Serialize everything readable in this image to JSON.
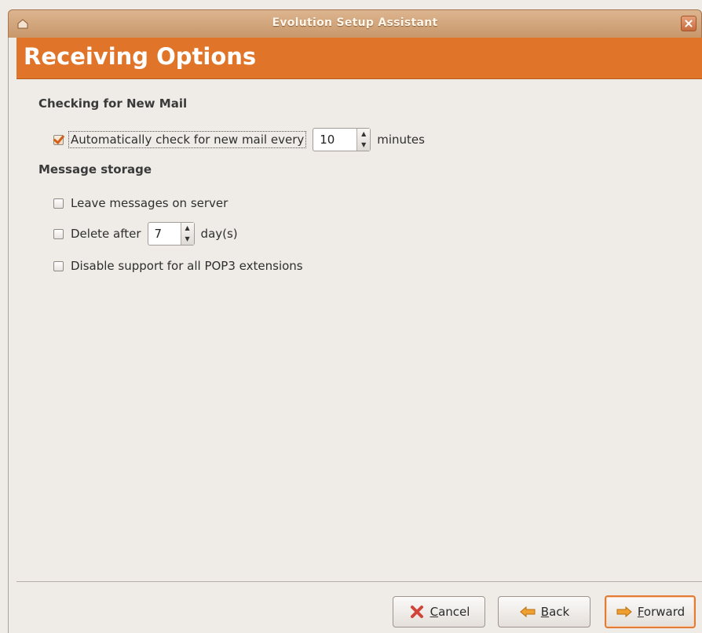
{
  "window": {
    "title": "Evolution Setup Assistant"
  },
  "page": {
    "heading": "Receiving Options"
  },
  "sections": {
    "checking": {
      "title": "Checking for New Mail",
      "auto_check_label": "Automatically check for new mail every",
      "auto_check_checked": true,
      "interval_value": "10",
      "interval_unit": "minutes"
    },
    "storage": {
      "title": "Message storage",
      "leave_on_server_label": "Leave messages on server",
      "leave_on_server_checked": false,
      "delete_after_label": "Delete after",
      "delete_after_checked": false,
      "delete_days_value": "7",
      "delete_days_unit": "day(s)",
      "disable_pop3_label": "Disable support for all POP3 extensions",
      "disable_pop3_checked": false
    }
  },
  "buttons": {
    "cancel_mnemonic": "C",
    "cancel_rest": "ancel",
    "back_mnemonic": "B",
    "back_rest": "ack",
    "forward_mnemonic": "F",
    "forward_rest": "orward"
  },
  "icons": {
    "window": "window-menu-icon",
    "close": "close-icon",
    "cancel": "cancel-icon",
    "back": "back-arrow-icon",
    "forward": "forward-arrow-icon"
  },
  "colors": {
    "accent": "#e0752a",
    "checkmark": "#d0611b"
  }
}
